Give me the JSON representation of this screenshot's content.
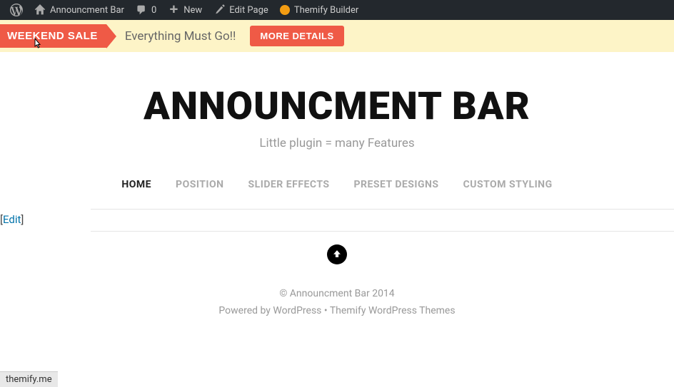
{
  "adminbar": {
    "site_name": "Announcment Bar",
    "comments_count": "0",
    "new_label": "New",
    "edit_page_label": "Edit Page",
    "themify_label": "Themify Builder"
  },
  "announcement": {
    "ribbon_text": "WEEKEND SALE",
    "message": "Everything Must Go!!",
    "button_label": "MORE DETAILS"
  },
  "site": {
    "title": "ANNOUNCMENT BAR",
    "tagline": "Little plugin = many Features"
  },
  "nav": {
    "items": [
      {
        "label": "HOME",
        "active": true
      },
      {
        "label": "POSITION",
        "active": false
      },
      {
        "label": "SLIDER EFFECTS",
        "active": false
      },
      {
        "label": "PRESET DESIGNS",
        "active": false
      },
      {
        "label": "CUSTOM STYLING",
        "active": false
      }
    ]
  },
  "page": {
    "edit_prefix": "[",
    "edit_label": "Edit",
    "edit_suffix": "]"
  },
  "footer": {
    "copyright": "© Announcment Bar 2014",
    "powered_prefix": "Powered by ",
    "powered_link": "WordPress",
    "separator": " • ",
    "theme_link": "Themify WordPress Themes"
  },
  "status": {
    "url": "themify.me"
  }
}
